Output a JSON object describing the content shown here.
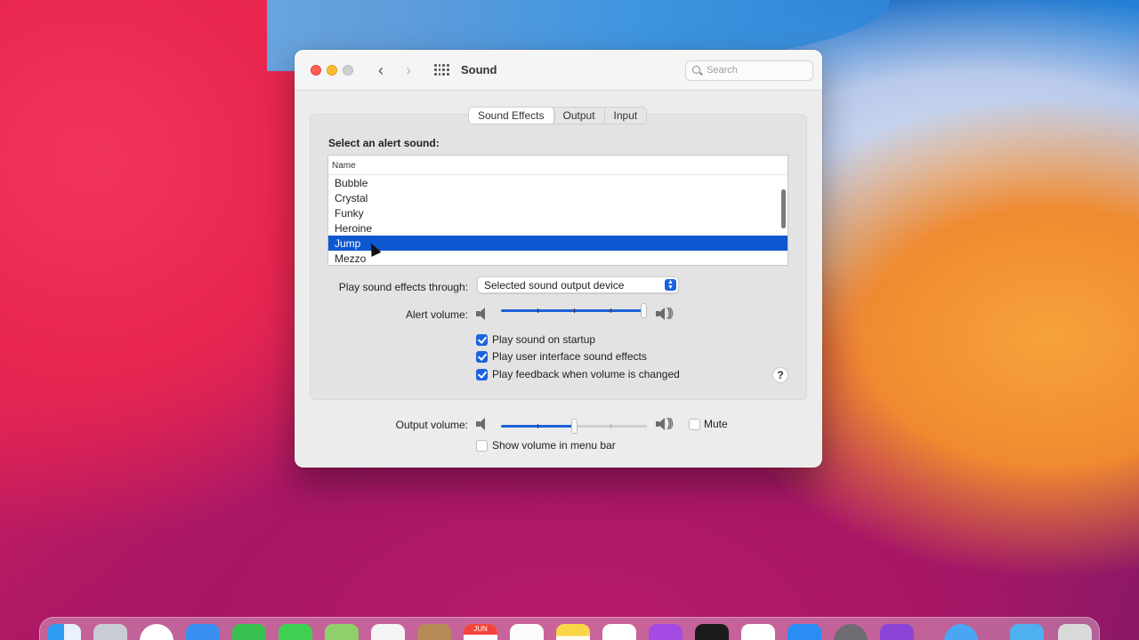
{
  "window": {
    "title": "Sound",
    "search_placeholder": "Search",
    "back_glyph": "‹",
    "forward_glyph": "›"
  },
  "tabs": [
    {
      "label": "Sound Effects",
      "active": true
    },
    {
      "label": "Output",
      "active": false
    },
    {
      "label": "Input",
      "active": false
    }
  ],
  "sound_effects": {
    "select_label": "Select an alert sound:",
    "list_header": "Name",
    "alerts": [
      "Bubble",
      "Crystal",
      "Funky",
      "Heroine",
      "Jump",
      "Mezzo"
    ],
    "selected_alert": "Jump",
    "play_through_label": "Play sound effects through:",
    "play_through_value": "Selected sound output device",
    "alert_volume_label": "Alert volume:",
    "alert_volume": 1.0,
    "checkboxes": [
      {
        "label": "Play sound on startup",
        "checked": true
      },
      {
        "label": "Play user interface sound effects",
        "checked": true
      },
      {
        "label": "Play feedback when volume is changed",
        "checked": true
      }
    ],
    "help_label": "?"
  },
  "output": {
    "volume_label": "Output volume:",
    "volume": 0.5,
    "mute_label": "Mute",
    "mute_checked": false,
    "show_in_menubar_label": "Show volume in menu bar",
    "show_in_menubar_checked": false
  },
  "dock": {
    "calendar_month": "JUN",
    "icons": [
      "finder-icon",
      "launchpad-icon",
      "safari-icon",
      "mail-icon",
      "facetime-icon",
      "messages-icon",
      "maps-icon",
      "photos-icon",
      "contacts-icon",
      "calendar-icon",
      "reminders-icon",
      "notes-icon",
      "music-icon",
      "podcasts-icon",
      "tv-icon",
      "news-icon",
      "app-store-icon",
      "system-preferences-icon",
      "feedback-icon",
      "screen-time-icon",
      "downloads-folder-icon",
      "trash-icon"
    ]
  }
}
